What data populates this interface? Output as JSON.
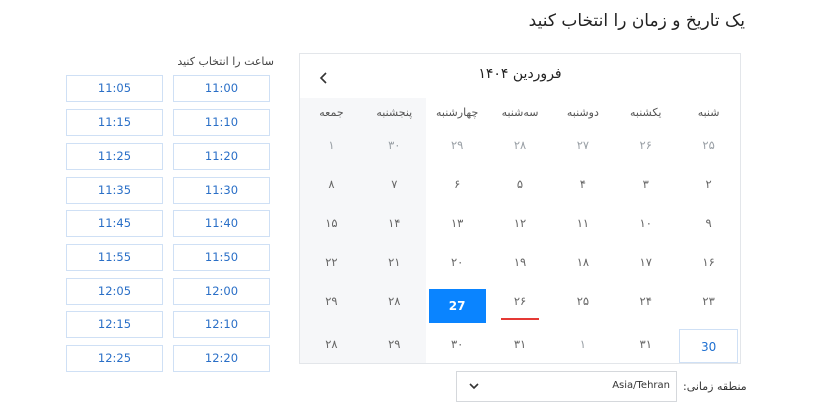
{
  "title": "یک تاریخ و زمان را انتخاب کنید",
  "calendar": {
    "month_label": "فروردین ۱۴۰۴",
    "weekdays": [
      "شنبه",
      "یکشنبه",
      "دوشنبه",
      "سه‌شنبه",
      "چهارشنبه",
      "پنجشنبه",
      "جمعه"
    ],
    "weeks": [
      [
        "۲۵",
        "۲۶",
        "۲۷",
        "۲۸",
        "۲۹",
        "۳۰",
        "۱"
      ],
      [
        "۲",
        "۳",
        "۴",
        "۵",
        "۶",
        "۷",
        "۸"
      ],
      [
        "۹",
        "۱۰",
        "۱۱",
        "۱۲",
        "۱۳",
        "۱۴",
        "۱۵"
      ],
      [
        "۱۶",
        "۱۷",
        "۱۸",
        "۱۹",
        "۲۰",
        "۲۱",
        "۲۲"
      ],
      [
        "۲۳",
        "۲۴",
        "۲۵",
        "۲۶",
        "27",
        "۲۸",
        "۲۹"
      ],
      [
        "30",
        "۳۱",
        "۱",
        "۳۱",
        "۳۰",
        "۲۹",
        "۲۸"
      ]
    ],
    "selected_label": "27",
    "today_label": "30",
    "accent_color": "#0a84ff"
  },
  "times": {
    "label": "ساعت را انتخاب کنید",
    "slots": [
      [
        "11:00",
        "11:05"
      ],
      [
        "11:10",
        "11:15"
      ],
      [
        "11:20",
        "11:25"
      ],
      [
        "11:30",
        "11:35"
      ],
      [
        "11:40",
        "11:45"
      ],
      [
        "11:50",
        "11:55"
      ],
      [
        "12:00",
        "12:05"
      ],
      [
        "12:10",
        "12:15"
      ],
      [
        "12:20",
        "12:25"
      ]
    ]
  },
  "timezone": {
    "label": "منطقه زمانی:",
    "value": "Asia/Tehran"
  }
}
